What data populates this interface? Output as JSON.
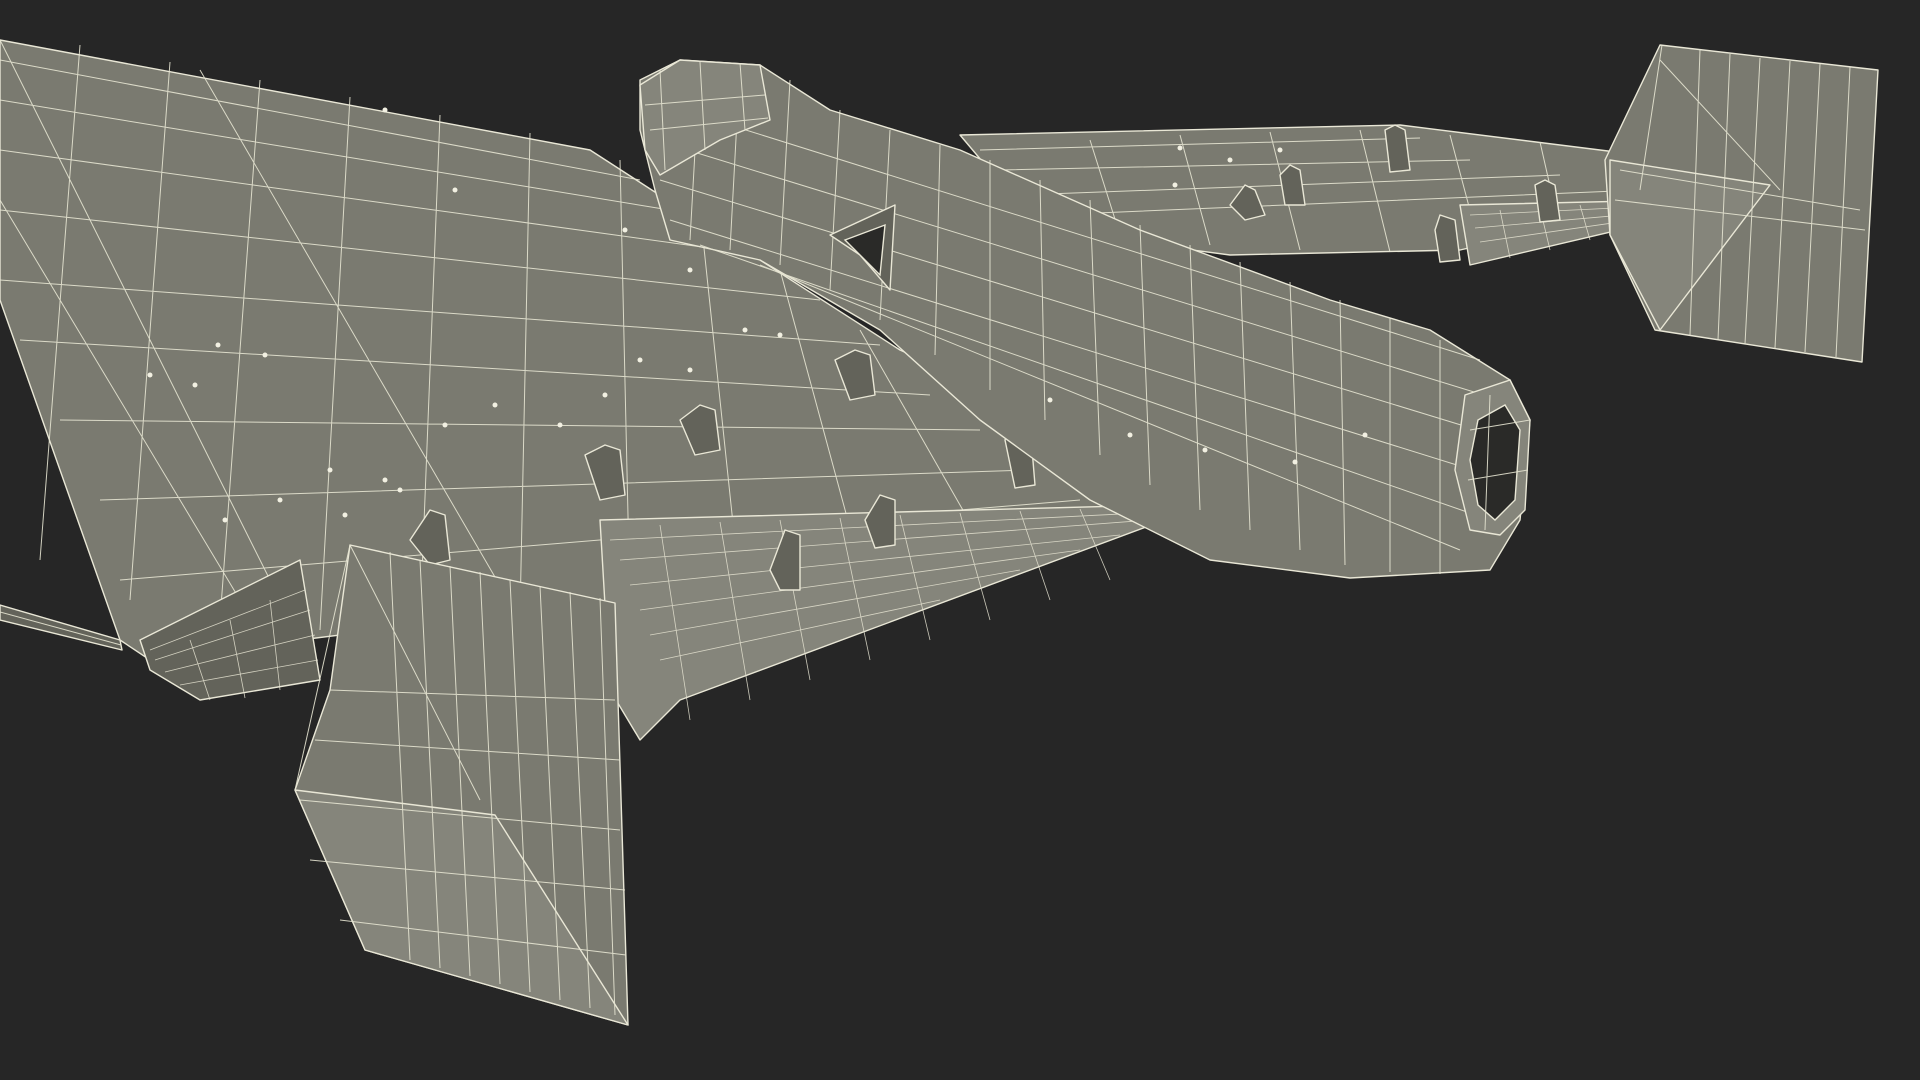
{
  "scene": {
    "subject": "wireframe-aircraft-model",
    "background_color": "#262626",
    "surface_color": "#7a7a70",
    "wire_color": "#e9e7d6"
  }
}
